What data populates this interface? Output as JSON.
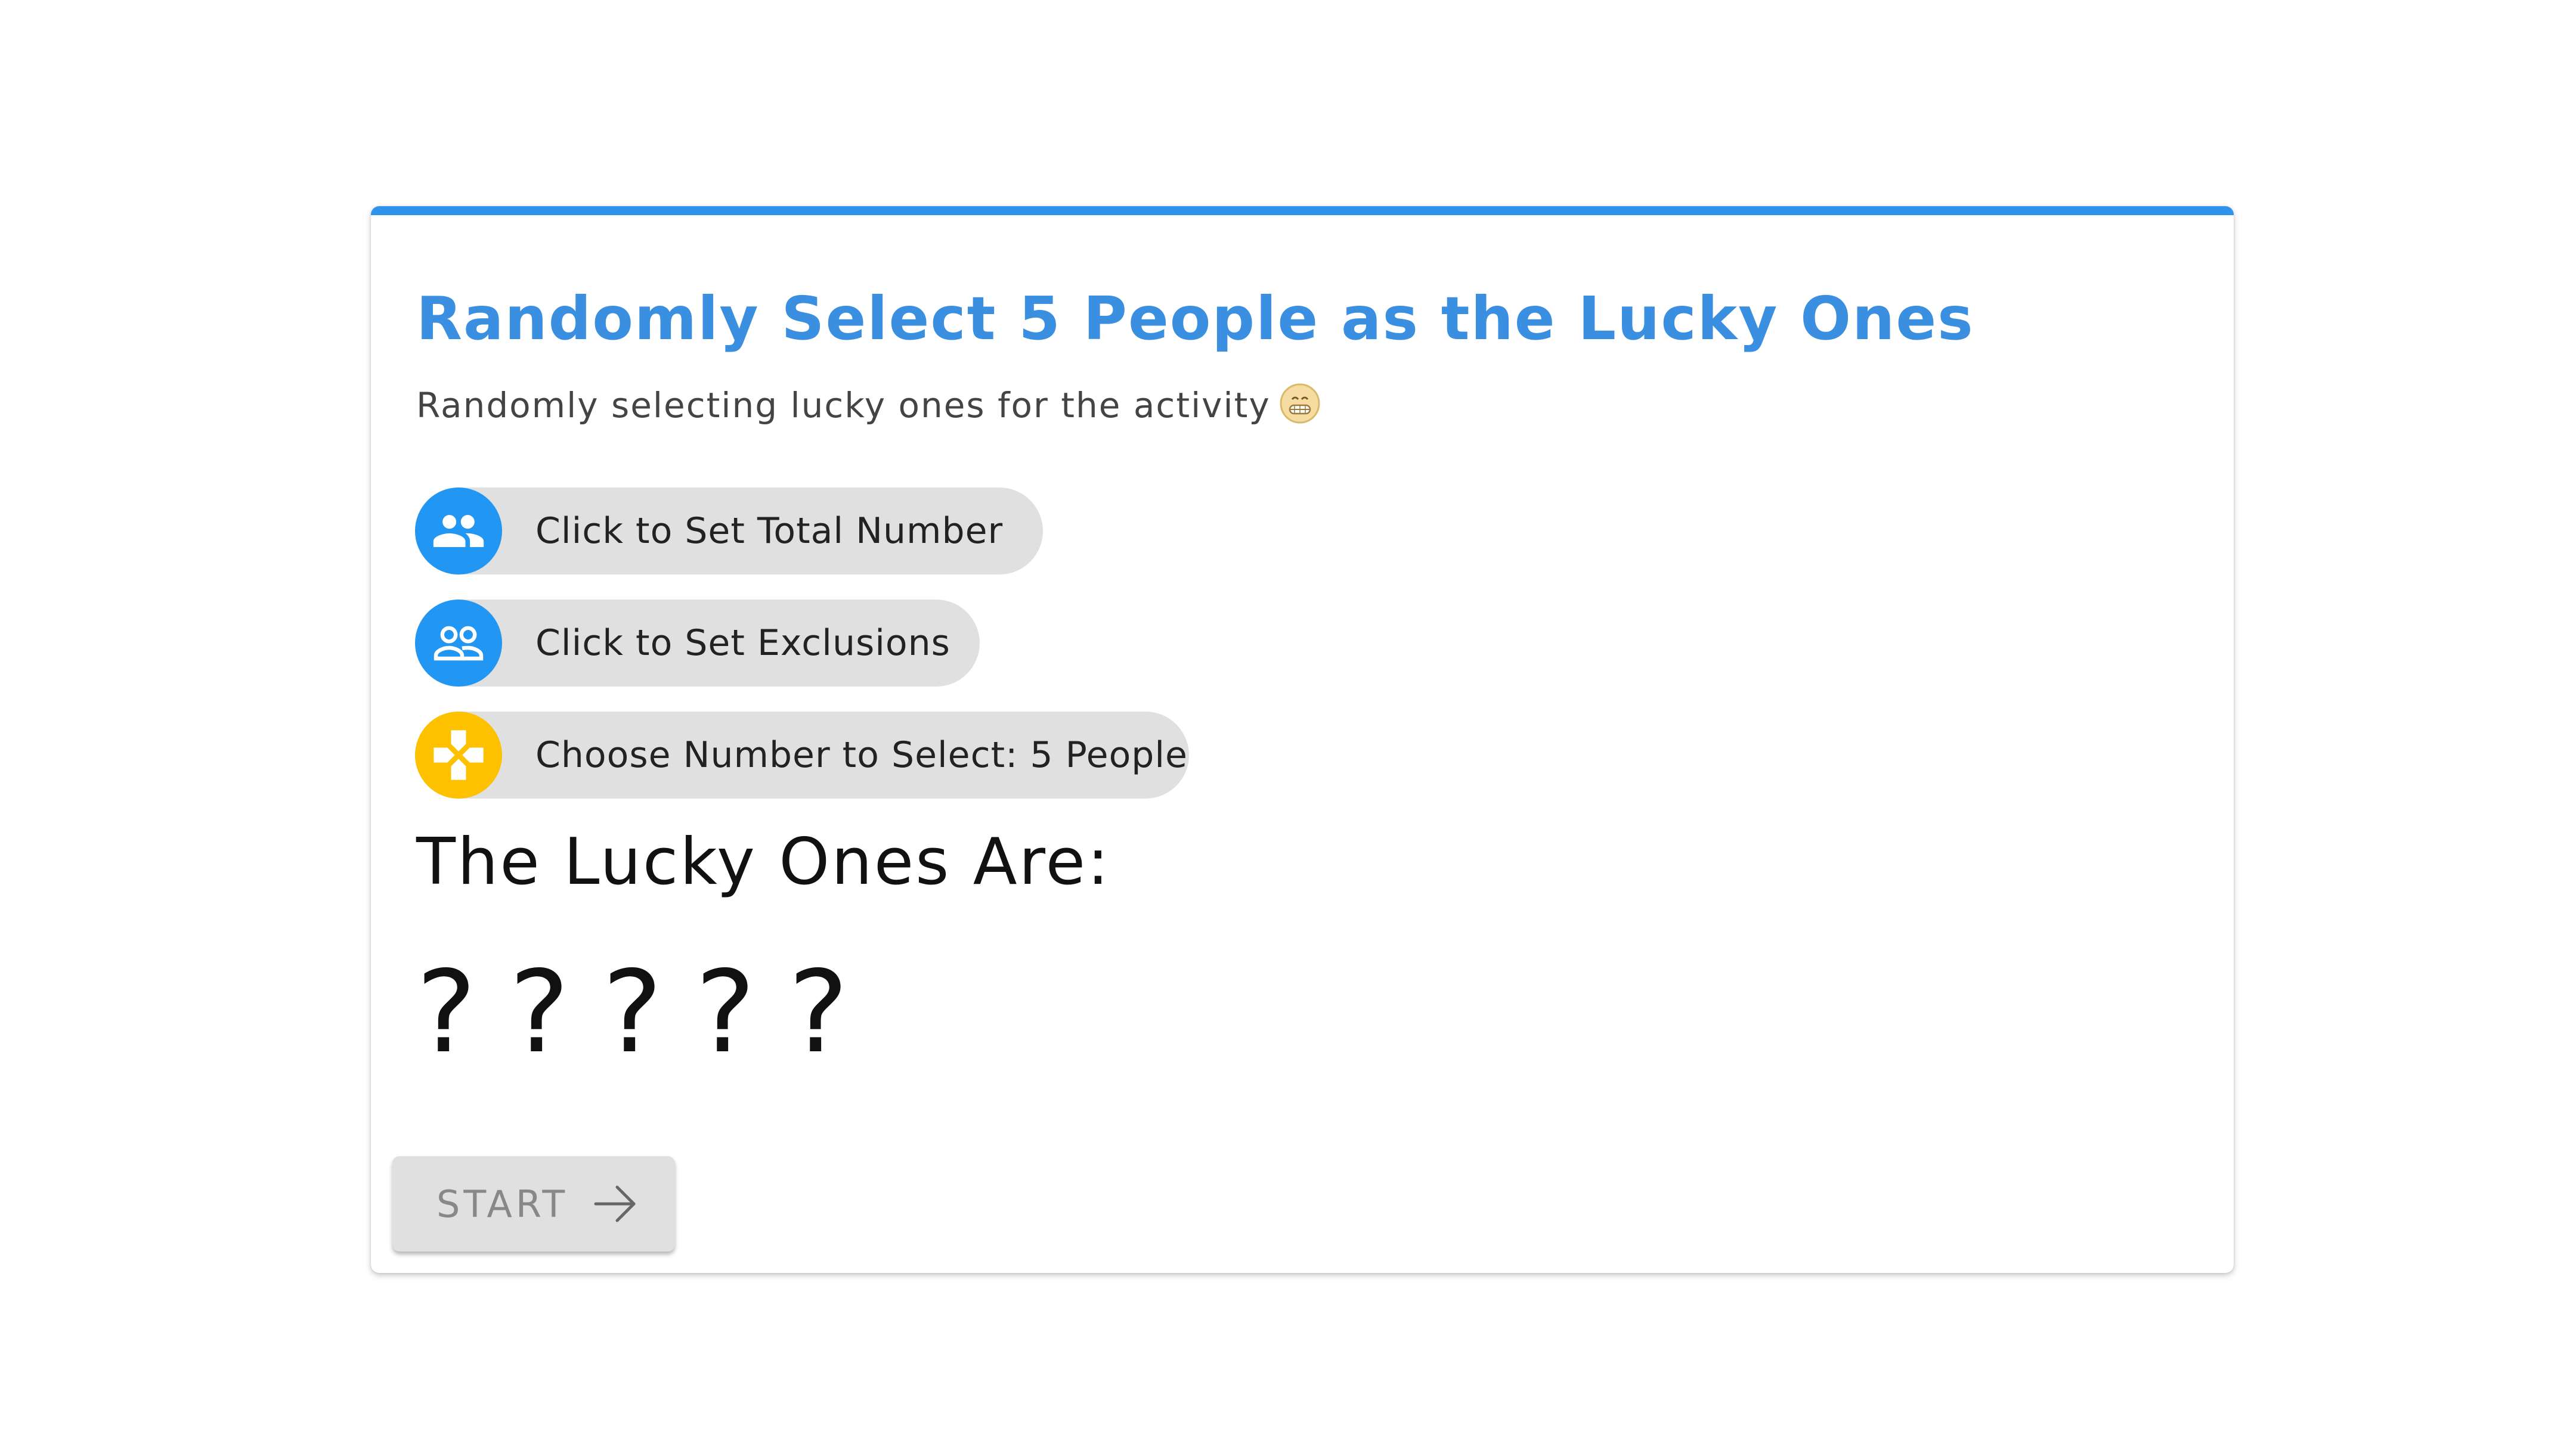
{
  "card": {
    "title": "Randomly Select 5 People as the Lucky Ones",
    "subtitle": "Randomly selecting lucky ones for the activity",
    "subtitle_emoji": "grinning-face-icon"
  },
  "chips": {
    "total": {
      "label": "Click to Set Total Number",
      "icon": "people-icon"
    },
    "exclusions": {
      "label": "Click to Set Exclusions",
      "icon": "people-outline-icon"
    },
    "choose": {
      "label": "Choose Number to Select: 5 People",
      "icon": "gamepad-icon"
    }
  },
  "results": {
    "heading": "The Lucky Ones Are:",
    "slots": [
      "?",
      "?",
      "?",
      "?",
      "?"
    ]
  },
  "start_button": {
    "label": "START",
    "icon": "arrow-right-icon",
    "disabled": true
  },
  "colors": {
    "accent": "#2e93ea",
    "title": "#3a8fe0",
    "chip_background": "#e0e0e0",
    "icon_blue": "#2196f3",
    "icon_yellow": "#fdc100",
    "button_disabled_text": "#888888"
  }
}
